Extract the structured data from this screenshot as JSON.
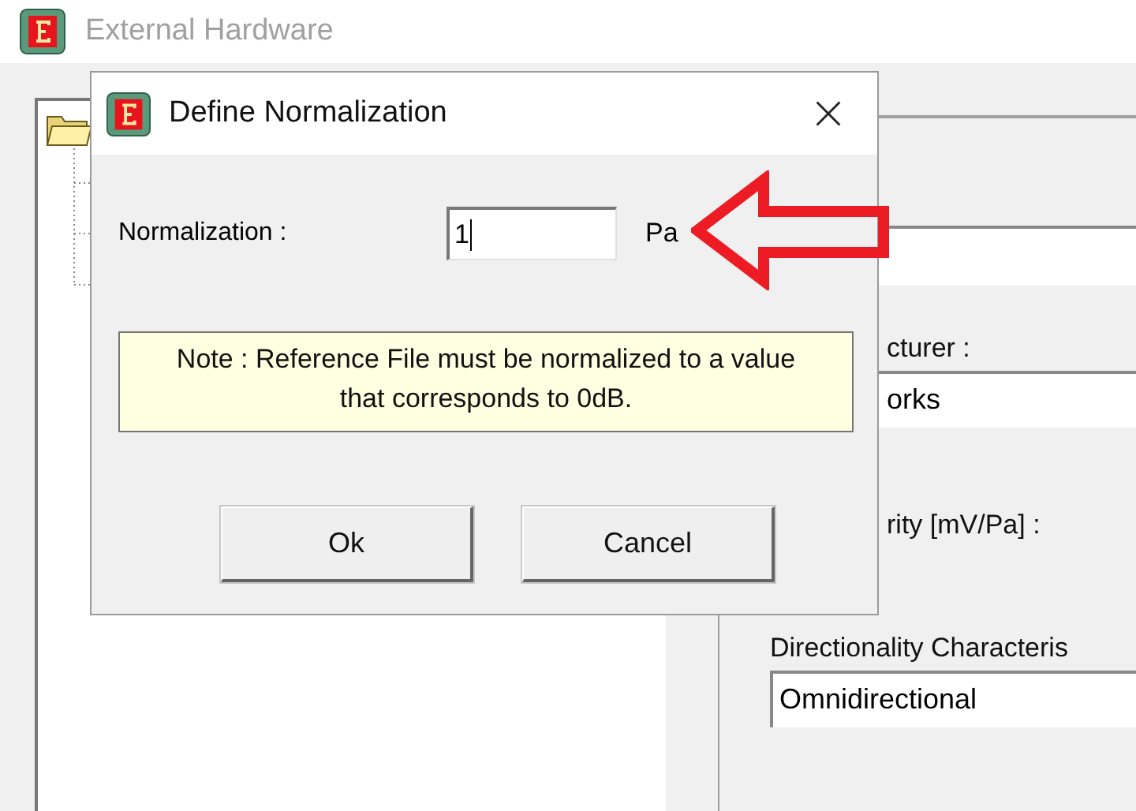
{
  "window": {
    "title": "External Hardware"
  },
  "properties": [
    {
      "label": "cturer :",
      "value": "orks"
    },
    {
      "label": "rity [mV/Pa] :"
    },
    {
      "label": "Directionality Characteris",
      "value": "Omnidirectional"
    }
  ],
  "dialog": {
    "title": "Define Normalization",
    "field_label": "Normalization :",
    "value": "1",
    "unit": "Pa",
    "note": "Note : Reference File must be normalized to a value that corresponds to 0dB.",
    "buttons": [
      "Ok",
      "Cancel"
    ]
  }
}
